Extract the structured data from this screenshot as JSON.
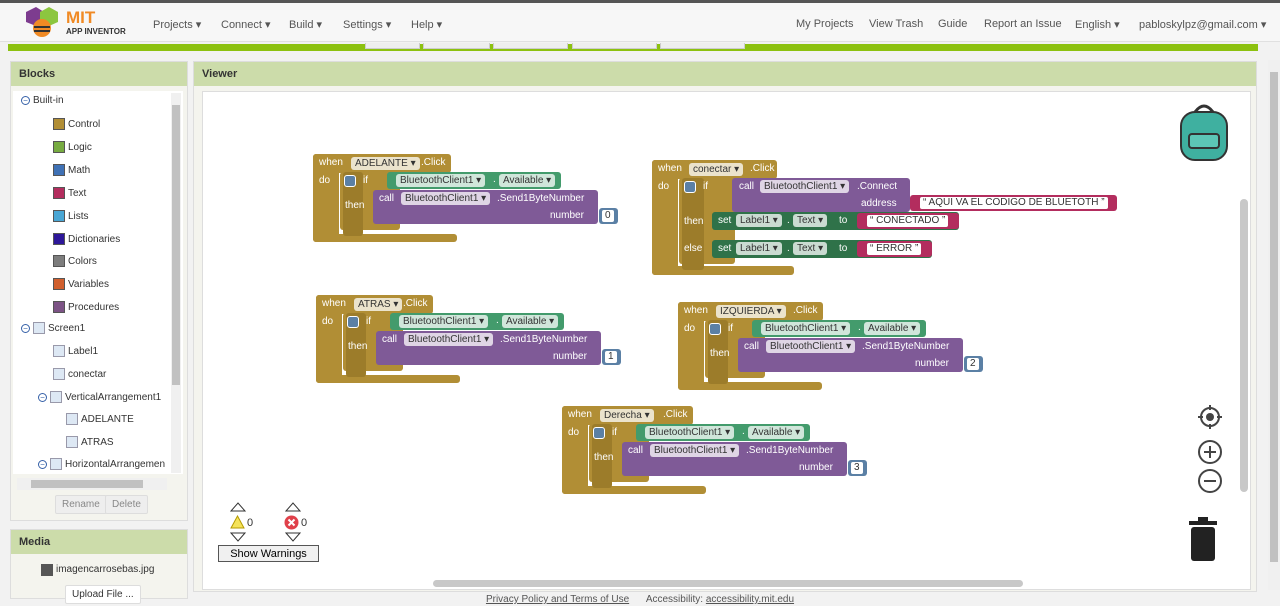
{
  "header": {
    "logo_title": "MIT",
    "logo_subtitle": "APP INVENTOR",
    "menu": [
      "Projects ▾",
      "Connect ▾",
      "Build ▾",
      "Settings ▾",
      "Help ▾"
    ],
    "right_links": [
      "My Projects",
      "View Trash",
      "Guide",
      "Report an Issue",
      "English ▾",
      "pabloskylpz@gmail.com ▾"
    ]
  },
  "blocks_panel": {
    "title": "Blocks",
    "tree": [
      {
        "label": "Built-in",
        "type": "group",
        "level": 0
      },
      {
        "label": "Control",
        "color": "#b18e35",
        "level": 1
      },
      {
        "label": "Logic",
        "color": "#77ab41",
        "level": 1
      },
      {
        "label": "Math",
        "color": "#3f71b5",
        "level": 1
      },
      {
        "label": "Text",
        "color": "#b32d5e",
        "level": 1
      },
      {
        "label": "Lists",
        "color": "#49a6d4",
        "level": 1
      },
      {
        "label": "Dictionaries",
        "color": "#2d1799",
        "level": 1
      },
      {
        "label": "Colors",
        "color": "#7d7d7d",
        "level": 1
      },
      {
        "label": "Variables",
        "color": "#d05f2d",
        "level": 1
      },
      {
        "label": "Procedures",
        "color": "#7c5385",
        "level": 1
      },
      {
        "label": "Screen1",
        "type": "group",
        "level": 0
      },
      {
        "label": "Label1",
        "type": "comp",
        "level": 1
      },
      {
        "label": "conectar",
        "type": "comp",
        "level": 1
      },
      {
        "label": "VerticalArrangement1",
        "type": "group",
        "level": 1
      },
      {
        "label": "ADELANTE",
        "type": "comp",
        "level": 2
      },
      {
        "label": "ATRAS",
        "type": "comp",
        "level": 2
      },
      {
        "label": "HorizontalArrangemen",
        "type": "group",
        "level": 1
      }
    ],
    "rename": "Rename",
    "delete": "Delete"
  },
  "media_panel": {
    "title": "Media",
    "file": "imagencarrosebas.jpg",
    "upload": "Upload File ..."
  },
  "viewer": {
    "title": "Viewer",
    "warnings_count": "0",
    "errors_count": "0",
    "show_warnings": "Show Warnings",
    "events": [
      {
        "kw_when": "when",
        "component": "ADELANTE",
        "event": ".Click",
        "kw_do": "do",
        "kw_if": "if",
        "kw_then": "then",
        "getter_comp": "BluetoothClient1",
        "getter_prop": "Available",
        "kw_call": "call",
        "call_comp": "BluetoothClient1",
        "method": ".Send1ByteNumber",
        "arg": "number",
        "value": "0"
      },
      {
        "kw_when": "when",
        "component": "ATRAS",
        "event": ".Click",
        "kw_do": "do",
        "kw_if": "if",
        "kw_then": "then",
        "getter_comp": "BluetoothClient1",
        "getter_prop": "Available",
        "kw_call": "call",
        "call_comp": "BluetoothClient1",
        "method": ".Send1ByteNumber",
        "arg": "number",
        "value": "1"
      },
      {
        "kw_when": "when",
        "component": "IZQUIERDA",
        "event": ".Click",
        "kw_do": "do",
        "kw_if": "if",
        "kw_then": "then",
        "getter_comp": "BluetoothClient1",
        "getter_prop": "Available",
        "kw_call": "call",
        "call_comp": "BluetoothClient1",
        "method": ".Send1ByteNumber",
        "arg": "number",
        "value": "2"
      },
      {
        "kw_when": "when",
        "component": "Derecha",
        "event": ".Click",
        "kw_do": "do",
        "kw_if": "if",
        "kw_then": "then",
        "getter_comp": "BluetoothClient1",
        "getter_prop": "Available",
        "kw_call": "call",
        "call_comp": "BluetoothClient1",
        "method": ".Send1ByteNumber",
        "arg": "number",
        "value": "3"
      }
    ],
    "connect_event": {
      "kw_when": "when",
      "component": "conectar",
      "event": ".Click",
      "kw_do": "do",
      "kw_if": "if",
      "kw_then": "then",
      "kw_else": "else",
      "kw_call": "call",
      "call_comp": "BluetoothClient1",
      "method": ".Connect",
      "arg": "address",
      "address": "AQUI VA EL CODIGO DE BLUETOTH",
      "kw_set": "set",
      "set_comp": "Label1",
      "set_prop": "Text",
      "kw_to": "to",
      "then_text": "CONECTADO",
      "else_text": "ERROR"
    },
    "colors": {
      "event": "#b18e35",
      "getter": "#439b6c",
      "call": "#7f5a97",
      "set": "#2f7249",
      "text": "#b32d5e",
      "number": "#5b80a5"
    }
  },
  "footer": {
    "privacy": "Privacy Policy and Terms of Use",
    "accessibility_label": "Accessibility:",
    "accessibility_link": "accessibility.mit.edu"
  }
}
